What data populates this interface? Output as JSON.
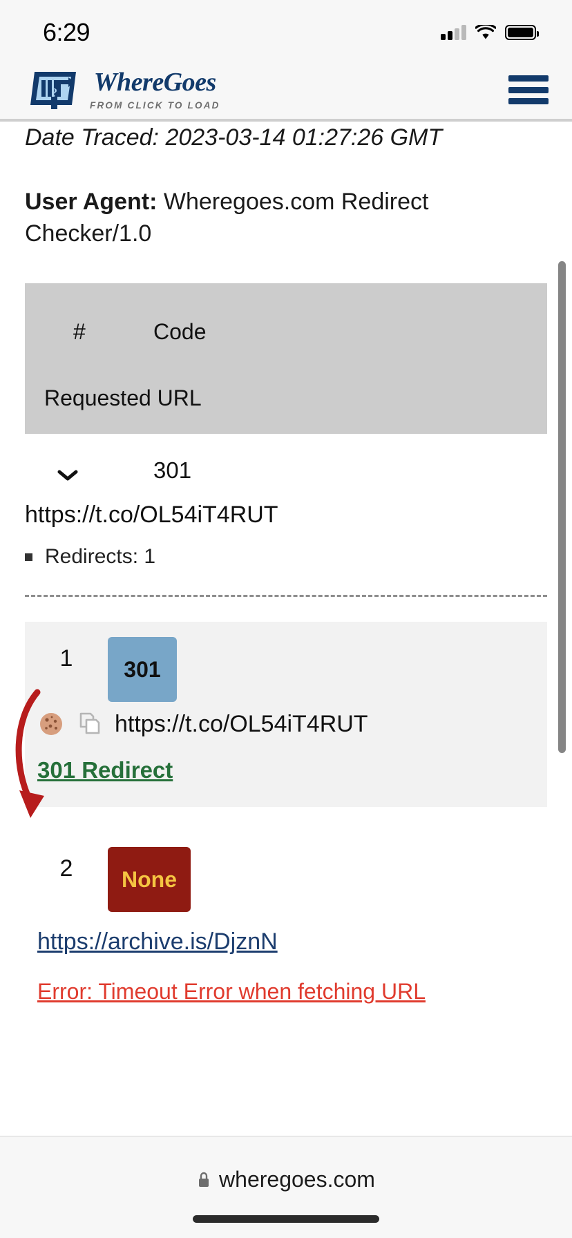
{
  "status_bar": {
    "time": "6:29",
    "icons": [
      "cellular-signal-icon",
      "wifi-icon",
      "battery-icon"
    ]
  },
  "site_header": {
    "brand_line1": "WhereGoes",
    "brand_where": "Where",
    "brand_goes": "Goes",
    "tagline": "FROM CLICK TO LOAD",
    "menu_icon": "hamburger-menu-icon"
  },
  "trace": {
    "date_traced": "Date Traced: 2023-03-14 01:27:26 GMT",
    "user_agent_label": "User Agent:",
    "user_agent_value": "Wheregoes.com Redirect Checker/1.0"
  },
  "table": {
    "col_num": "#",
    "col_code": "Code",
    "col_url": "Requested URL"
  },
  "summary": {
    "expand_icon": "chevron-down-icon",
    "code": "301",
    "url": "https://t.co/OL54iT4RUT",
    "redirects_label": "Redirects: 1"
  },
  "hops": [
    {
      "num": "1",
      "code": "301",
      "code_color": "#78a6c8",
      "url": "https://t.co/OL54iT4RUT",
      "note": "301 Redirect",
      "note_color": "#26703a",
      "cookie_icon": "cookie-icon",
      "copy_icon": "copy-icon"
    },
    {
      "num": "2",
      "code": "None",
      "code_color": "#8f1b12",
      "code_text_color": "#f5c542",
      "url": "https://archive.is/DjznN",
      "error": "Error: Timeout Error when fetching URL",
      "error_color": "#e03b2e"
    }
  ],
  "browser_bar": {
    "lock_icon": "lock-icon",
    "domain": "wheregoes.com"
  }
}
